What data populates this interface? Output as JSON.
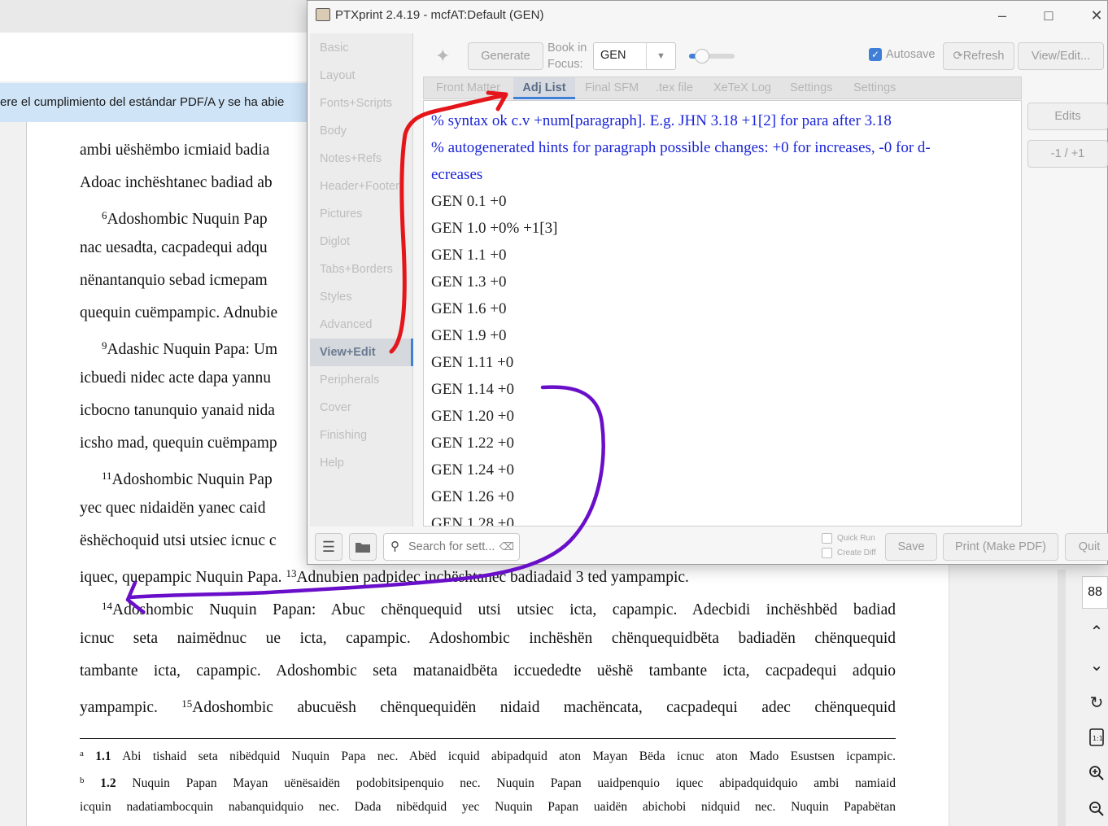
{
  "background_doc": {
    "info_bar_text": "ere el cumplimiento del estándar PDF/A y se ha abie",
    "lines": [
      {
        "html": "ambi uëshëmbo icmiaid badia"
      },
      {
        "html": "Adoac inchështanec badiad ab"
      },
      {
        "html": "<sup>6</sup>Adoshombic Nuquin Pap"
      },
      {
        "html": "nac uesadta, cacpadequi adqu"
      },
      {
        "html": "nënantanquio sebad icmepam"
      },
      {
        "html": "quequin cuëmpampic. Adnubie"
      },
      {
        "html": "<sup>9</sup>Adashic Nuquin Papa: Um"
      },
      {
        "html": "icbuedi nidec acte dapa yannu"
      },
      {
        "html": "icbocno tanunquio yanaid nida"
      },
      {
        "html": "icsho mad, quequin cuëmpamp"
      },
      {
        "html": "<sup>11</sup>Adoshombic Nuquin Pap"
      },
      {
        "html": "yec quec nidaidën yanec caid"
      },
      {
        "html": "ëshëchoquid utsi utsiec icnuc c"
      },
      {
        "html": "iquec, quepampic Nuquin Papa. <sup>13</sup>Adnubien padpidec inchështanec badiadaid 3 ted yampampic."
      },
      {
        "html": "<sup>14</sup>Adoshombic Nuquin Papan: Abuc chënquequid utsi utsiec icta, capampic. Adecbidi inchëshbëd badiad"
      },
      {
        "html": "icnuc seta naimëdnuc ue icta, capampic. Adoshombic inchëshën chënquequidbëta badiadën chënquequid"
      },
      {
        "html": "tambante icta, capampic. Adoshombic seta matanaidbëta iccuededte uëshë tambante icta, cacpadequi adquio"
      },
      {
        "html": "yampampic. <sup>15</sup>Adoshombic abucuësh chënquequidën nidaid machëncata, cacpadequi adec chënquequid"
      }
    ],
    "footnotes": [
      {
        "html": "<sup>a</sup> <b>1.1</b> Abi tishaid seta nibëdquid Nuquin Papa nec. Abëd icquid abipadquid aton Mayan Bëda icnuc aton Mado Esustsen icpampic."
      },
      {
        "html": "<sup>b</sup> <b>1.2</b> Nuquin Papan Mayan uënësaidën podobitsipenquio nec. Nuquin Papan uaidpenquio iquec abipadquidquio ambi namiaid"
      },
      {
        "html": "icquin nadatiambocquin nabanquidquio nec. Dada nibëdquid yec Nuquin Papan uaidën abichobi nidquid nec. Nuquin Papabëtan"
      }
    ],
    "page_number": "88"
  },
  "window": {
    "title": "PTXprint 2.4.19  -  mcfAT:Default  (GEN)",
    "sidebar": [
      "Basic",
      "Layout",
      "Fonts+Scripts",
      "Body",
      "Notes+Refs",
      "Header+Footer",
      "Pictures",
      "Diglot",
      "Tabs+Borders",
      "Styles",
      "Advanced",
      "View+Edit",
      "Peripherals",
      "Cover",
      "Finishing",
      "Help"
    ],
    "sidebar_active": "View+Edit",
    "toolbar": {
      "generate": "Generate",
      "book_in_focus_line1": "Book in",
      "book_in_focus_line2": "Focus:",
      "book_value": "GEN",
      "autosave": "Autosave",
      "refresh": "Refresh",
      "view_edit": "View/Edit..."
    },
    "tabs": [
      "Front Matter",
      "Adj List",
      "Final SFM",
      ".tex file",
      "XeTeX Log",
      "Settings",
      "Settings"
    ],
    "active_tab": "Adj List",
    "editor_lines": [
      "% syntax ok c.v  +num[paragraph]. E.g. JHN 3.18  +1[2] for para after 3.18",
      "% autogenerated hints for paragraph possible changes:  +0 for increases, -0 for d-",
      "ecreases",
      "GEN 0.1  +0",
      "GEN 1.0  +0%  +1[3]",
      "GEN 1.1  +0",
      "GEN 1.3  +0",
      "GEN 1.6  +0",
      "GEN 1.9  +0",
      "GEN 1.11  +0",
      "GEN 1.14  +0",
      "GEN 1.20  +0",
      "GEN 1.22  +0",
      "GEN 1.24  +0",
      "GEN 1.26  +0",
      "GEN 1.28  +0"
    ],
    "right_buttons": {
      "edits": "Edits",
      "adjust": "-1 / +1"
    },
    "bottom": {
      "search_placeholder": "Search for sett...",
      "quick_run": "Quick Run",
      "create_diff": "Create Diff",
      "save": "Save",
      "print": "Print (Make PDF)",
      "quit": "Quit"
    }
  },
  "colors": {
    "accent": "#3f7fd8",
    "comment_text": "#1a24d8",
    "annotation_red": "#e4161b",
    "annotation_purple": "#6a0fc9"
  }
}
